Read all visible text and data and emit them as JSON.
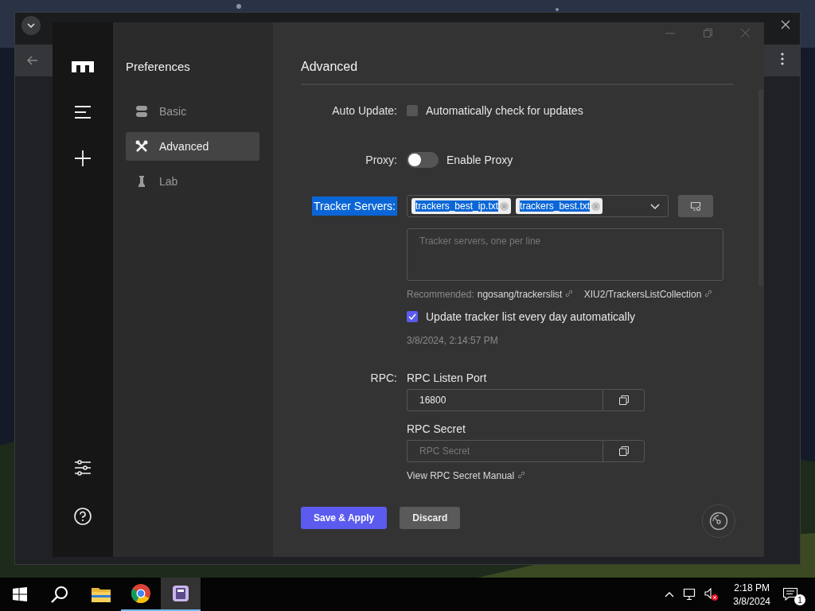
{
  "app": {
    "title": "Preferences",
    "nav": [
      {
        "label": "Basic",
        "selected": false
      },
      {
        "label": "Advanced",
        "selected": true
      },
      {
        "label": "Lab",
        "selected": false
      }
    ],
    "heading": "Advanced",
    "auto_update": {
      "label": "Auto Update:",
      "text": "Automatically check for updates",
      "checked": false
    },
    "proxy": {
      "label": "Proxy:",
      "text": "Enable Proxy",
      "on": false
    },
    "tracker": {
      "label": "Tracker Servers:",
      "highlighted": true,
      "tags": [
        {
          "text": "trackers_best_ip.txt",
          "highlighted": true
        },
        {
          "text": "trackers_best.txt",
          "highlighted": true
        }
      ],
      "placeholder": "Tracker servers, one per line",
      "recommended_label": "Recommended:",
      "links": [
        "ngosang/trackerslist",
        "XIU2/TrackersListCollection"
      ],
      "daily": {
        "text": "Update tracker list every day automatically",
        "checked": true
      },
      "updated_at": "3/8/2024, 2:14:57 PM"
    },
    "rpc": {
      "label": "RPC:",
      "port_label": "RPC Listen Port",
      "port_value": "16800",
      "secret_label": "RPC Secret",
      "secret_placeholder": "RPC Secret",
      "manual_link": "View RPC Secret Manual"
    },
    "buttons": [
      {
        "label": "Save & Apply",
        "kind": "primary"
      },
      {
        "label": "Discard",
        "kind": "secondary"
      }
    ]
  },
  "taskbar": {
    "apps": [
      {
        "kind": "files",
        "running": false,
        "selected": false
      },
      {
        "kind": "browser",
        "running": true,
        "selected": false
      },
      {
        "kind": "motrix",
        "running": true,
        "selected": true
      }
    ],
    "time": "2:18 PM",
    "date": "3/8/2024",
    "notifications": "1"
  }
}
